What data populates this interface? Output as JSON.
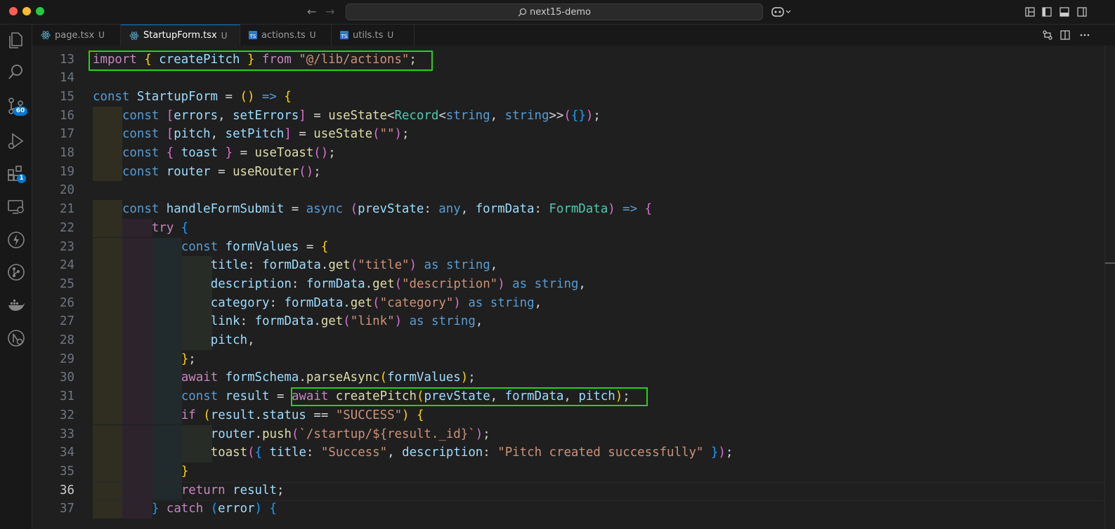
{
  "titlebar": {
    "title": "next15-demo"
  },
  "tabs": [
    {
      "label": "page.tsx",
      "modified": "U"
    },
    {
      "label": "StartupForm.tsx",
      "modified": "U"
    },
    {
      "label": "actions.ts",
      "modified": "U"
    },
    {
      "label": "utils.ts",
      "modified": "U"
    }
  ],
  "activity_badges": {
    "source_control": "60",
    "extensions": "1"
  },
  "icons": [
    "search-icon",
    "copilot-icon",
    "layout-icon",
    "sidebar-icon",
    "panel-icon",
    "explorer-icon",
    "source-control-icon",
    "run-debug-icon",
    "extensions-icon",
    "remote-explorer-icon",
    "lightning-icon",
    "git-graph-icon",
    "docker-icon",
    "accessibility-icon",
    "compare-icon",
    "split-editor-icon",
    "more-icon"
  ],
  "colors": {
    "highlight_box": "#22d31a",
    "accent": "#0078d4"
  },
  "current_line": "36",
  "editor": {
    "line_numbers": [
      "13",
      "14",
      "15",
      "16",
      "17",
      "18",
      "19",
      "20",
      "21",
      "22",
      "23",
      "24",
      "25",
      "26",
      "27",
      "28",
      "29",
      "30",
      "31",
      "32",
      "33",
      "34",
      "35",
      "36",
      "37"
    ],
    "lines": [
      "import { createPitch } from \"@/lib/actions\";",
      "",
      "const StartupForm = () => {",
      "    const [errors, setErrors] = useState<Record<string, string>>({});",
      "    const [pitch, setPitch] = useState(\"\");",
      "    const { toast } = useToast();",
      "    const router = useRouter();",
      "",
      "    const handleFormSubmit = async (prevState: any, formData: FormData) => {",
      "        try {",
      "            const formValues = {",
      "                title: formData.get(\"title\") as string,",
      "                description: formData.get(\"description\") as string,",
      "                category: formData.get(\"category\") as string,",
      "                link: formData.get(\"link\") as string,",
      "                pitch,",
      "            };",
      "            await formSchema.parseAsync(formValues);",
      "            const result = await createPitch(prevState, formData, pitch);",
      "            if (result.status == \"SUCCESS\") {",
      "                router.push(`/startup/${result._id}`);",
      "                toast({ title: \"Success\", description: \"Pitch created successfully\" });",
      "            }",
      "            return result;",
      "        } catch (error) {"
    ]
  }
}
